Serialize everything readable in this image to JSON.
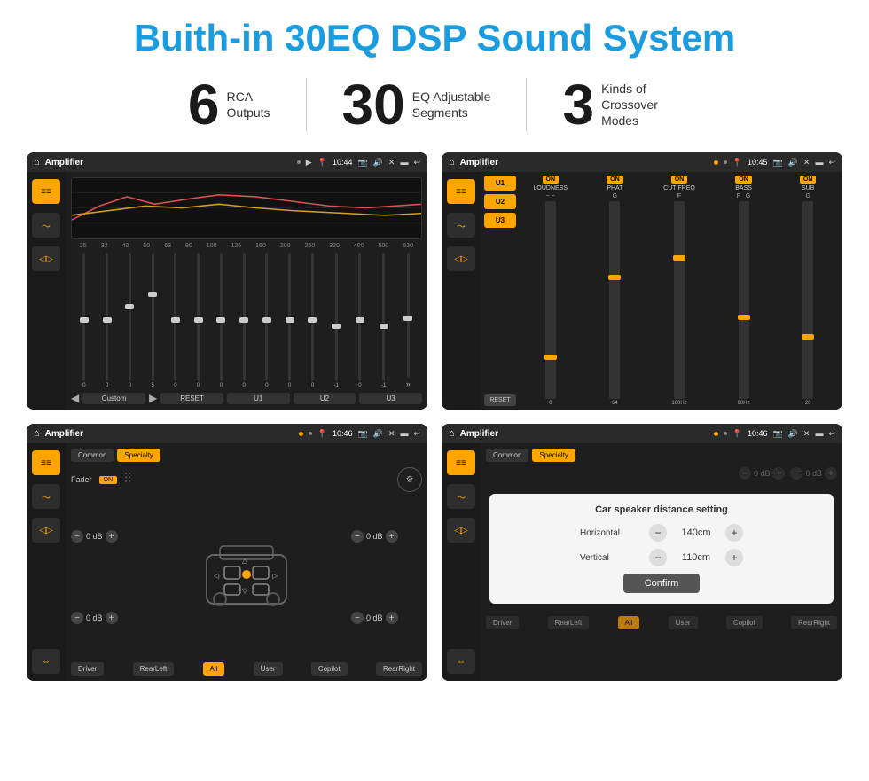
{
  "title": "Buith-in 30EQ DSP Sound System",
  "stats": [
    {
      "number": "6",
      "label": "RCA\nOutputs"
    },
    {
      "number": "30",
      "label": "EQ Adjustable\nSegments"
    },
    {
      "number": "3",
      "label": "Kinds of\nCrossover Modes"
    }
  ],
  "screens": {
    "eq": {
      "topbar": {
        "title": "Amplifier",
        "time": "10:44"
      },
      "freqs": [
        "25",
        "32",
        "40",
        "50",
        "63",
        "80",
        "100",
        "125",
        "160",
        "200",
        "250",
        "320",
        "400",
        "500",
        "630"
      ],
      "values": [
        "0",
        "0",
        "0",
        "5",
        "0",
        "0",
        "0",
        "0",
        "0",
        "0",
        "0",
        "-1",
        "0",
        "-1"
      ],
      "bottom_btns": [
        "Custom",
        "RESET",
        "U1",
        "U2",
        "U3"
      ]
    },
    "dsp": {
      "topbar": {
        "title": "Amplifier",
        "time": "10:45"
      },
      "presets": [
        "U1",
        "U2",
        "U3"
      ],
      "channels": [
        {
          "on": true,
          "label": "LOUDNESS"
        },
        {
          "on": true,
          "label": "PHAT"
        },
        {
          "on": true,
          "label": "CUT FREQ"
        },
        {
          "on": true,
          "label": "BASS"
        },
        {
          "on": true,
          "label": "SUB"
        }
      ],
      "reset_label": "RESET"
    },
    "crossover": {
      "topbar": {
        "title": "Amplifier",
        "time": "10:46"
      },
      "tabs": [
        "Common",
        "Specialty"
      ],
      "fader_label": "Fader",
      "fader_on": true,
      "channel_values": [
        "0 dB",
        "0 dB",
        "0 dB",
        "0 dB"
      ],
      "bottom_btns": [
        "Driver",
        "RearLeft",
        "All",
        "User",
        "Copilot",
        "RearRight"
      ]
    },
    "distance": {
      "topbar": {
        "title": "Amplifier",
        "time": "10:46"
      },
      "tabs": [
        "Common",
        "Specialty"
      ],
      "dialog": {
        "title": "Car speaker distance setting",
        "horizontal_label": "Horizontal",
        "horizontal_value": "140cm",
        "vertical_label": "Vertical",
        "vertical_value": "110cm",
        "confirm_label": "Confirm"
      },
      "channel_values": [
        "0 dB",
        "0 dB"
      ],
      "bottom_btns": [
        "Driver",
        "RearLeft",
        "All",
        "User",
        "Copilot",
        "RearRight"
      ]
    }
  }
}
